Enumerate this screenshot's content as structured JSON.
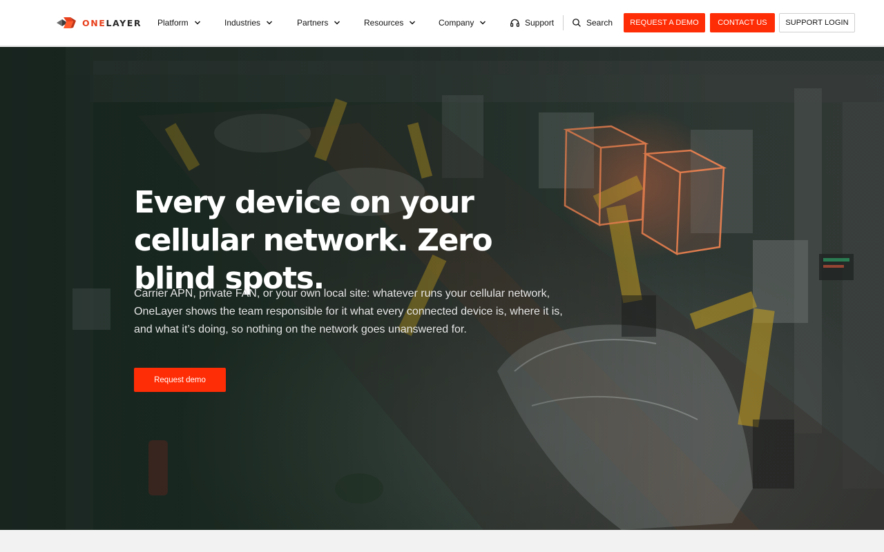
{
  "brand": {
    "name_part1": "ONE",
    "name_part2": "LAYER",
    "accent": "#e8401c",
    "logo_icon": "onelayer-cube-logo"
  },
  "nav": {
    "items": [
      {
        "label": "Platform"
      },
      {
        "label": "Industries"
      },
      {
        "label": "Partners"
      },
      {
        "label": "Resources"
      },
      {
        "label": "Company"
      }
    ],
    "support_label": "Support",
    "support_icon": "headset-icon",
    "search_label": "Search",
    "search_icon": "search-icon"
  },
  "actions": {
    "request_demo": "REQUEST A DEMO",
    "contact_us": "CONTACT US",
    "support_login": "SUPPORT LOGIN",
    "cta_color": "#ff2d06"
  },
  "hero": {
    "title": "Every device on your cellular network. Zero blind spots.",
    "body": "Carrier APN, private FAN, or your own local site: whatever runs your cellular network, OneLayer shows the team responsible for it what every connected device is, where it is, and what it’s doing, so nothing on the network goes unanswered for.",
    "cta_label": "Request demo",
    "background": "factory-robots-car-assembly-image"
  }
}
